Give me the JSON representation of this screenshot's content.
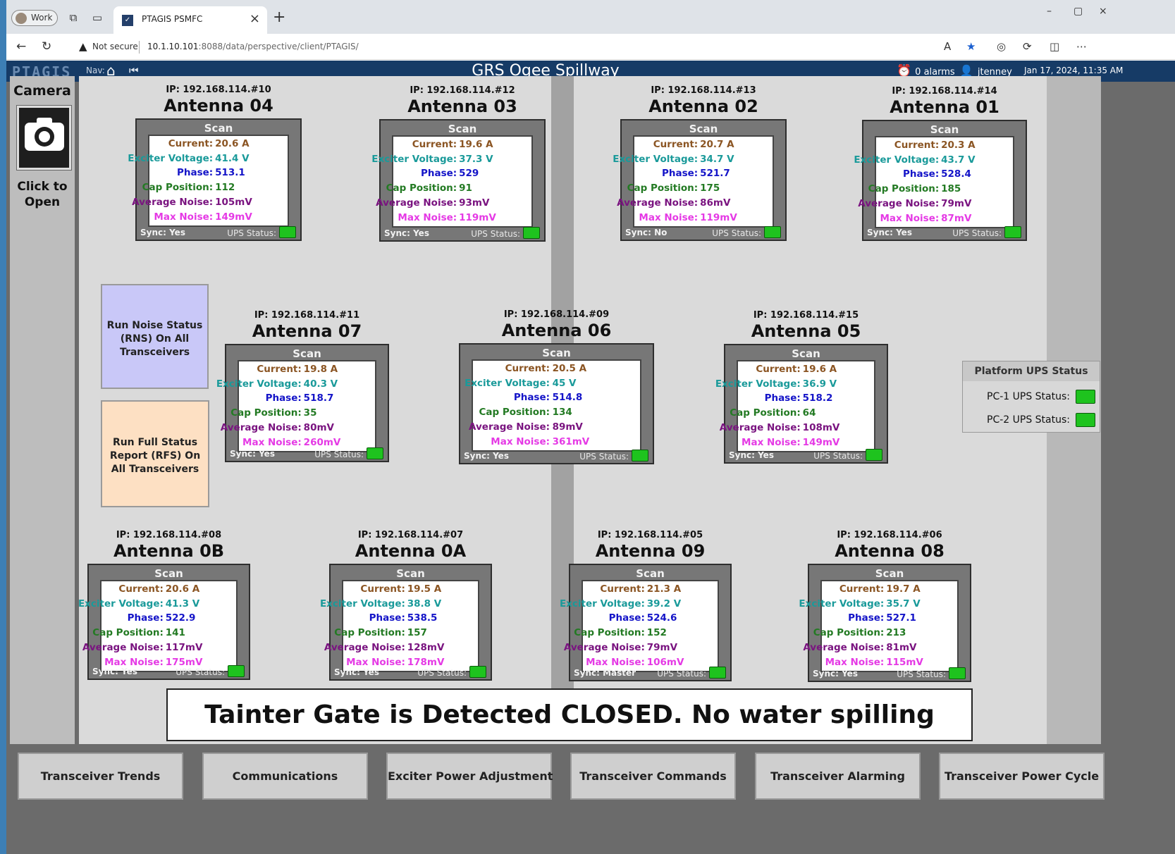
{
  "browser": {
    "profile": "Work",
    "tab_title": "PTAGIS PSMFC",
    "not_secure": "Not secure",
    "url_host": "10.1.10.101",
    "url_rest": ":8088/data/perspective/client/PTAGIS/"
  },
  "header": {
    "logo": "PTAGIS",
    "nav_label": "Nav:",
    "title": "GRS Ogee Spillway",
    "alarms": "0 alarms",
    "user": "jtenney",
    "datetime": "Jan 17, 2024, 11:35 AM"
  },
  "camera": {
    "title": "Camera",
    "subtitle": "Click to Open"
  },
  "labels": {
    "scan": "Scan",
    "current": "Current:",
    "exciter": "Exciter Voltage:",
    "phase": "Phase:",
    "cap": "Cap Position:",
    "avg": "Average Noise:",
    "max": "Max Noise:",
    "ups": "UPS Status:"
  },
  "antennas": [
    {
      "ip": "IP: 192.168.114.#10",
      "name": "Antenna 04",
      "current": "20.6 A",
      "exciter": "41.4 V",
      "phase": "513.1",
      "cap": "112",
      "avg": "105mV",
      "max": "149mV",
      "sync": "Sync: Yes"
    },
    {
      "ip": "IP: 192.168.114.#12",
      "name": "Antenna 03",
      "current": "19.6 A",
      "exciter": "37.3 V",
      "phase": "529",
      "cap": "91",
      "avg": "93mV",
      "max": "119mV",
      "sync": "Sync: Yes"
    },
    {
      "ip": "IP: 192.168.114.#13",
      "name": "Antenna 02",
      "current": "20.7 A",
      "exciter": "34.7 V",
      "phase": "521.7",
      "cap": "175",
      "avg": "86mV",
      "max": "119mV",
      "sync": "Sync: No"
    },
    {
      "ip": "IP: 192.168.114.#14",
      "name": "Antenna 01",
      "current": "20.3 A",
      "exciter": "43.7 V",
      "phase": "528.4",
      "cap": "185",
      "avg": "79mV",
      "max": "87mV",
      "sync": "Sync: Yes"
    },
    {
      "ip": "IP: 192.168.114.#11",
      "name": "Antenna 07",
      "current": "19.8 A",
      "exciter": "40.3 V",
      "phase": "518.7",
      "cap": "35",
      "avg": "80mV",
      "max": "260mV",
      "sync": "Sync: Yes"
    },
    {
      "ip": "IP: 192.168.114.#09",
      "name": "Antenna 06",
      "current": "20.5 A",
      "exciter": "45 V",
      "phase": "514.8",
      "cap": "134",
      "avg": "89mV",
      "max": "361mV",
      "sync": "Sync: Yes"
    },
    {
      "ip": "IP: 192.168.114.#15",
      "name": "Antenna 05",
      "current": "19.6 A",
      "exciter": "36.9 V",
      "phase": "518.2",
      "cap": "64",
      "avg": "108mV",
      "max": "149mV",
      "sync": "Sync: Yes"
    },
    {
      "ip": "IP: 192.168.114.#08",
      "name": "Antenna 0B",
      "current": "20.6 A",
      "exciter": "41.3 V",
      "phase": "522.9",
      "cap": "141",
      "avg": "117mV",
      "max": "175mV",
      "sync": "Sync: Yes"
    },
    {
      "ip": "IP: 192.168.114.#07",
      "name": "Antenna 0A",
      "current": "19.5 A",
      "exciter": "38.8 V",
      "phase": "538.5",
      "cap": "157",
      "avg": "128mV",
      "max": "178mV",
      "sync": "Sync: Yes"
    },
    {
      "ip": "IP: 192.168.114.#05",
      "name": "Antenna 09",
      "current": "21.3 A",
      "exciter": "39.2 V",
      "phase": "524.6",
      "cap": "152",
      "avg": "79mV",
      "max": "106mV",
      "sync": "Sync: Master"
    },
    {
      "ip": "IP: 192.168.114.#06",
      "name": "Antenna 08",
      "current": "19.7 A",
      "exciter": "35.7 V",
      "phase": "527.1",
      "cap": "213",
      "avg": "81mV",
      "max": "115mV",
      "sync": "Sync: Yes"
    }
  ],
  "buttons": {
    "rns": "Run Noise Status (RNS) On All Transceivers",
    "rfs": "Run Full Status Report (RFS) On All Transceivers"
  },
  "platform_ups": {
    "title": "Platform UPS Status",
    "pc1": "PC-1 UPS Status:",
    "pc2": "PC-2 UPS Status:"
  },
  "gate_status": "Tainter Gate is Detected CLOSED. No water spilling",
  "footer": [
    "Transceiver Trends",
    "Communications",
    "Exciter Power Adjustment",
    "Transceiver Commands",
    "Transceiver Alarming",
    "Transceiver Power Cycle"
  ],
  "colors": {
    "header_bg": "#163b66",
    "ups_ok": "#1ec31e",
    "current": "#8b5523",
    "exciter": "#1a9a9a",
    "phase": "#1414c8",
    "cap": "#237a23",
    "avg_noise": "#7a1480",
    "max_noise": "#e53ae5"
  }
}
